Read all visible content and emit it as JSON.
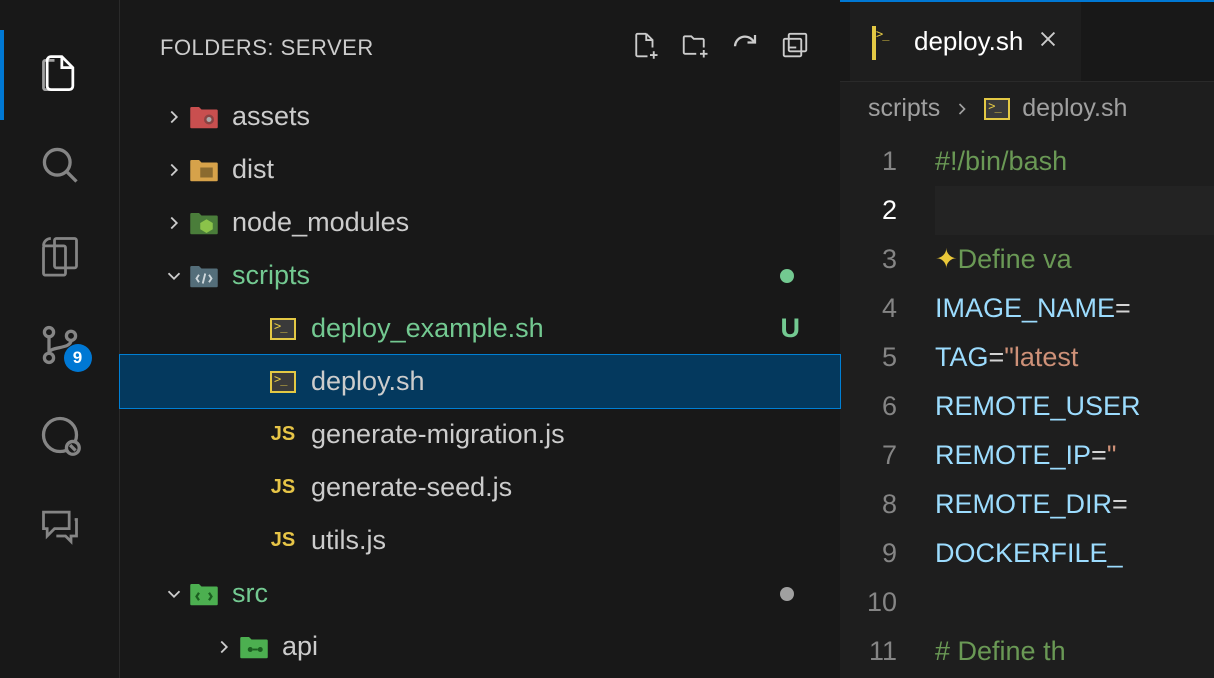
{
  "activityBar": {
    "items": [
      {
        "name": "explorer",
        "active": true
      },
      {
        "name": "search",
        "active": false
      },
      {
        "name": "outline",
        "active": false
      },
      {
        "name": "source-control",
        "active": false,
        "badge": "9"
      },
      {
        "name": "timeline",
        "active": false
      },
      {
        "name": "chat",
        "active": false
      }
    ]
  },
  "explorer": {
    "title": "FOLDERS: SERVER",
    "tree": [
      {
        "kind": "folder",
        "label": "assets",
        "depth": 0,
        "expanded": false,
        "icon": "folder-assets"
      },
      {
        "kind": "folder",
        "label": "dist",
        "depth": 0,
        "expanded": false,
        "icon": "folder-dist"
      },
      {
        "kind": "folder",
        "label": "node_modules",
        "depth": 0,
        "expanded": false,
        "icon": "folder-node"
      },
      {
        "kind": "folder",
        "label": "scripts",
        "depth": 0,
        "expanded": true,
        "icon": "folder-scripts",
        "green": true,
        "dot": "green"
      },
      {
        "kind": "file",
        "label": "deploy_example.sh",
        "depth": 1,
        "icon": "shell",
        "green": true,
        "status": "U"
      },
      {
        "kind": "file",
        "label": "deploy.sh",
        "depth": 1,
        "icon": "shell",
        "selected": true
      },
      {
        "kind": "file",
        "label": "generate-migration.js",
        "depth": 1,
        "icon": "js"
      },
      {
        "kind": "file",
        "label": "generate-seed.js",
        "depth": 1,
        "icon": "js"
      },
      {
        "kind": "file",
        "label": "utils.js",
        "depth": 1,
        "icon": "js"
      },
      {
        "kind": "folder",
        "label": "src",
        "depth": 0,
        "expanded": true,
        "icon": "folder-src",
        "green": true,
        "dot": "gray"
      },
      {
        "kind": "folder",
        "label": "api",
        "depth": 1,
        "expanded": false,
        "icon": "folder-api"
      }
    ]
  },
  "editor": {
    "tab": {
      "label": "deploy.sh",
      "icon": "shell"
    },
    "breadcrumb": [
      "scripts",
      "deploy.sh"
    ],
    "activeLine": 2,
    "lines": [
      {
        "n": 1,
        "tokens": [
          {
            "c": "comment",
            "t": "#!/bin/bash"
          }
        ]
      },
      {
        "n": 2,
        "tokens": []
      },
      {
        "n": 3,
        "tokens": [
          {
            "c": "sparkle",
            "t": "✦"
          },
          {
            "c": "comment",
            "t": "Define va"
          }
        ]
      },
      {
        "n": 4,
        "tokens": [
          {
            "c": "var",
            "t": "IMAGE_NAME"
          },
          {
            "c": "text",
            "t": "="
          }
        ]
      },
      {
        "n": 5,
        "tokens": [
          {
            "c": "var",
            "t": "TAG"
          },
          {
            "c": "text",
            "t": "="
          },
          {
            "c": "str",
            "t": "\"latest"
          }
        ]
      },
      {
        "n": 6,
        "tokens": [
          {
            "c": "var",
            "t": "REMOTE_USER"
          }
        ]
      },
      {
        "n": 7,
        "tokens": [
          {
            "c": "var",
            "t": "REMOTE_IP"
          },
          {
            "c": "text",
            "t": "="
          },
          {
            "c": "str",
            "t": "\""
          }
        ]
      },
      {
        "n": 8,
        "tokens": [
          {
            "c": "var",
            "t": "REMOTE_DIR"
          },
          {
            "c": "text",
            "t": "="
          }
        ]
      },
      {
        "n": 9,
        "tokens": [
          {
            "c": "var",
            "t": "DOCKERFILE_"
          }
        ]
      },
      {
        "n": 10,
        "tokens": []
      },
      {
        "n": 11,
        "tokens": [
          {
            "c": "comment",
            "t": "# Define th"
          }
        ]
      }
    ]
  }
}
